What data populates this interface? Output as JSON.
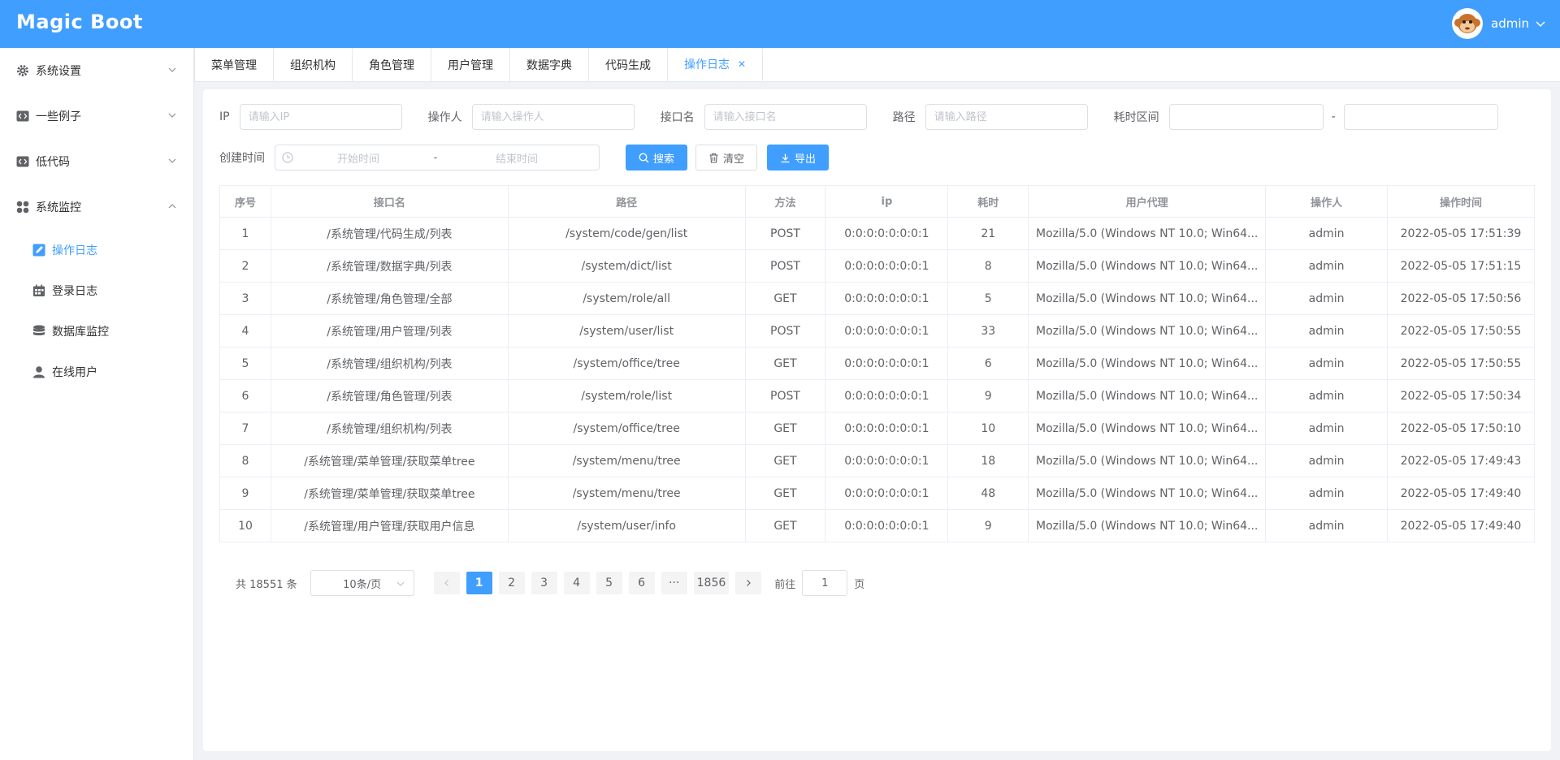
{
  "app": {
    "logo": "Magic Boot",
    "user_name": "admin"
  },
  "sidebar": {
    "groups": [
      {
        "label": "系统设置",
        "icon": "gear-icon",
        "expanded": false
      },
      {
        "label": "一些例子",
        "icon": "code-icon",
        "expanded": false
      },
      {
        "label": "低代码",
        "icon": "code-icon",
        "expanded": false
      },
      {
        "label": "系统监控",
        "icon": "dashboard-icon",
        "expanded": true
      }
    ],
    "sub_items": [
      {
        "label": "操作日志",
        "icon": "edit-icon",
        "active": true
      },
      {
        "label": "登录日志",
        "icon": "calendar-icon",
        "active": false
      },
      {
        "label": "数据库监控",
        "icon": "database-icon",
        "active": false
      },
      {
        "label": "在线用户",
        "icon": "user-icon",
        "active": false
      }
    ]
  },
  "tabs": [
    "菜单管理",
    "组织机构",
    "角色管理",
    "用户管理",
    "数据字典",
    "代码生成",
    "操作日志"
  ],
  "active_tab": "操作日志",
  "filters": {
    "ip_label": "IP",
    "ip_placeholder": "请输入IP",
    "operator_label": "操作人",
    "operator_placeholder": "请输入操作人",
    "api_label": "接口名",
    "api_placeholder": "请输入接口名",
    "path_label": "路径",
    "path_placeholder": "请输入路径",
    "cost_label": "耗时区间",
    "cost_sep": "-",
    "created_label": "创建时间",
    "start_placeholder": "开始时间",
    "date_sep": "-",
    "end_placeholder": "结束时间",
    "search_btn": "搜索",
    "clear_btn": "清空",
    "export_btn": "导出"
  },
  "table": {
    "headers": [
      "序号",
      "接口名",
      "路径",
      "方法",
      "ip",
      "耗时",
      "用户代理",
      "操作人",
      "操作时间"
    ],
    "rows": [
      [
        "1",
        "/系统管理/代码生成/列表",
        "/system/code/gen/list",
        "POST",
        "0:0:0:0:0:0:0:1",
        "21",
        "Mozilla/5.0 (Windows NT 10.0; Win64...",
        "admin",
        "2022-05-05 17:51:39"
      ],
      [
        "2",
        "/系统管理/数据字典/列表",
        "/system/dict/list",
        "POST",
        "0:0:0:0:0:0:0:1",
        "8",
        "Mozilla/5.0 (Windows NT 10.0; Win64...",
        "admin",
        "2022-05-05 17:51:15"
      ],
      [
        "3",
        "/系统管理/角色管理/全部",
        "/system/role/all",
        "GET",
        "0:0:0:0:0:0:0:1",
        "5",
        "Mozilla/5.0 (Windows NT 10.0; Win64...",
        "admin",
        "2022-05-05 17:50:56"
      ],
      [
        "4",
        "/系统管理/用户管理/列表",
        "/system/user/list",
        "POST",
        "0:0:0:0:0:0:0:1",
        "33",
        "Mozilla/5.0 (Windows NT 10.0; Win64...",
        "admin",
        "2022-05-05 17:50:55"
      ],
      [
        "5",
        "/系统管理/组织机构/列表",
        "/system/office/tree",
        "GET",
        "0:0:0:0:0:0:0:1",
        "6",
        "Mozilla/5.0 (Windows NT 10.0; Win64...",
        "admin",
        "2022-05-05 17:50:55"
      ],
      [
        "6",
        "/系统管理/角色管理/列表",
        "/system/role/list",
        "POST",
        "0:0:0:0:0:0:0:1",
        "9",
        "Mozilla/5.0 (Windows NT 10.0; Win64...",
        "admin",
        "2022-05-05 17:50:34"
      ],
      [
        "7",
        "/系统管理/组织机构/列表",
        "/system/office/tree",
        "GET",
        "0:0:0:0:0:0:0:1",
        "10",
        "Mozilla/5.0 (Windows NT 10.0; Win64...",
        "admin",
        "2022-05-05 17:50:10"
      ],
      [
        "8",
        "/系统管理/菜单管理/获取菜单tree",
        "/system/menu/tree",
        "GET",
        "0:0:0:0:0:0:0:1",
        "18",
        "Mozilla/5.0 (Windows NT 10.0; Win64...",
        "admin",
        "2022-05-05 17:49:43"
      ],
      [
        "9",
        "/系统管理/菜单管理/获取菜单tree",
        "/system/menu/tree",
        "GET",
        "0:0:0:0:0:0:0:1",
        "48",
        "Mozilla/5.0 (Windows NT 10.0; Win64...",
        "admin",
        "2022-05-05 17:49:40"
      ],
      [
        "10",
        "/系统管理/用户管理/获取用户信息",
        "/system/user/info",
        "GET",
        "0:0:0:0:0:0:0:1",
        "9",
        "Mozilla/5.0 (Windows NT 10.0; Win64...",
        "admin",
        "2022-05-05 17:49:40"
      ]
    ]
  },
  "pagination": {
    "total_text": "共 18551 条",
    "page_size": "10条/页",
    "pages": [
      "1",
      "2",
      "3",
      "4",
      "5",
      "6"
    ],
    "ellipsis": "···",
    "last_page": "1856",
    "current": "1",
    "goto_label": "前往",
    "goto_value": "1",
    "goto_suffix": "页"
  },
  "colors": {
    "primary": "#409eff",
    "header_bg": "#409eff"
  }
}
